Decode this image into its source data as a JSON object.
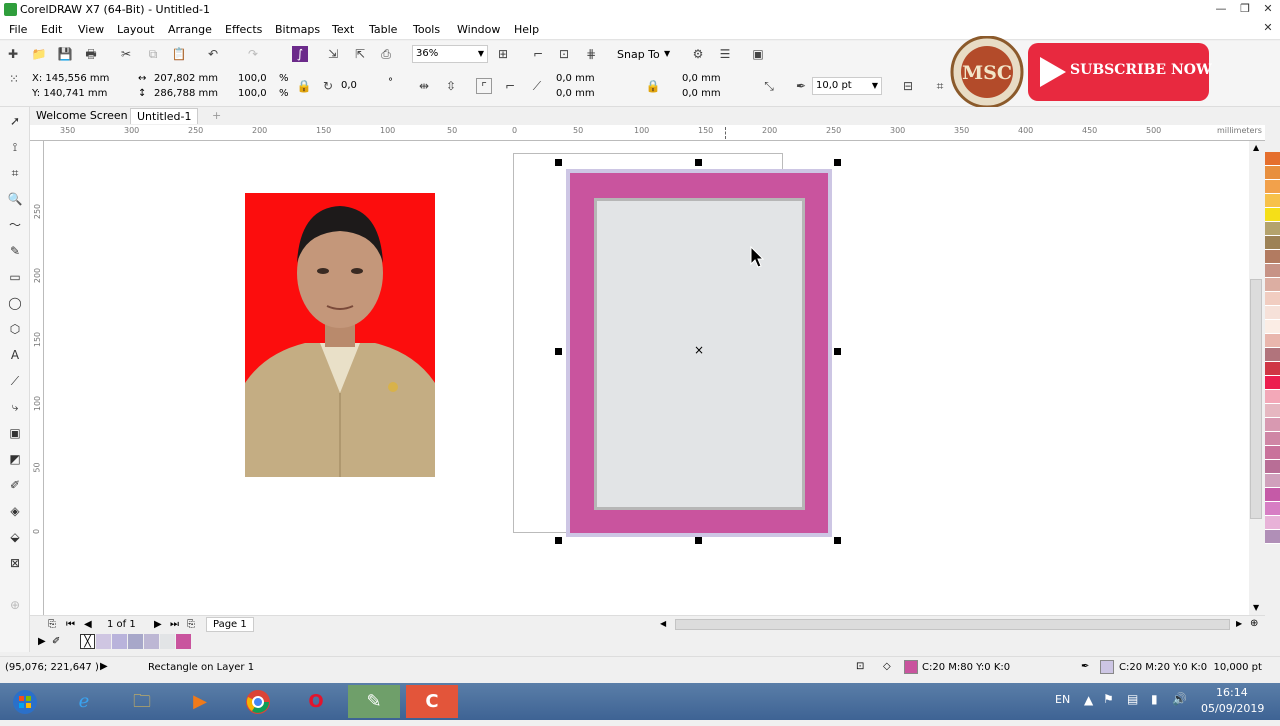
{
  "window": {
    "title": "CorelDRAW X7 (64-Bit) - Untitled-1"
  },
  "menu": [
    "File",
    "Edit",
    "View",
    "Layout",
    "Arrange",
    "Effects",
    "Bitmaps",
    "Text",
    "Table",
    "Tools",
    "Window",
    "Help"
  ],
  "toolbar": {
    "zoom": "36%",
    "snap_to": "Snap To"
  },
  "properties": {
    "x": "X: 145,556 mm",
    "y": "Y: 140,741 mm",
    "width": "207,802 mm",
    "height": "286,788 mm",
    "scale_w": "100,0",
    "scale_h": "100,0",
    "percent": "%",
    "rotation": "0,0",
    "degree": "°",
    "corner_tl": "0,0 mm",
    "corner_bl": "0,0 mm",
    "corner_tr": "0,0 mm",
    "corner_br": "0,0 mm",
    "outline_width": "10,0 pt"
  },
  "tabs": {
    "welcome": "Welcome Screen",
    "doc": "Untitled-1",
    "add": "+"
  },
  "ruler": {
    "units": "millimeters",
    "h_ticks": [
      "350",
      "300",
      "250",
      "200",
      "150",
      "100",
      "50",
      "0",
      "50",
      "100",
      "150",
      "200",
      "250",
      "300",
      "350",
      "400",
      "450",
      "500"
    ],
    "v_ticks": [
      "250",
      "200",
      "150",
      "100",
      "50",
      "0"
    ]
  },
  "page_nav": {
    "count": "1 of 1",
    "page_tab": "Page 1"
  },
  "status": {
    "coords": "(95,076; 221,647 )",
    "selection": "Rectangle on Layer 1",
    "fill": "C:20 M:80 Y:0 K:0",
    "outline": "C:20 M:20 Y:0 K:0  10,000 pt"
  },
  "overlay": {
    "subscribe": "SUBSCRIBE NOW",
    "logo_text": "MSC"
  },
  "taskbar": {
    "lang": "EN",
    "time": "16:14",
    "date": "05/09/2019"
  },
  "colors": {
    "fill": "#c9549e",
    "outline": "#cdc6e4",
    "inner": "#e2e4e6",
    "photo_bg": "#fc0d0d",
    "subscribe": "#e8293f"
  },
  "palette": [
    "#e56f2d",
    "#e88f3e",
    "#f2a14b",
    "#f7c14a",
    "#f5df18",
    "#b4a36d",
    "#9d8256",
    "#b27b61",
    "#c79386",
    "#dcaea2",
    "#f1cdc1",
    "#f6e1d9",
    "#fbede5",
    "#e9b6ad",
    "#b1747c",
    "#cf3645",
    "#ec1e4f",
    "#f3a8b8",
    "#e6b7c1",
    "#d899b1",
    "#cf86a5",
    "#c9729b",
    "#b86e96",
    "#d0a0bc",
    "#c55aa7",
    "#d77ec4",
    "#e8b2d8",
    "#b08fb7"
  ]
}
